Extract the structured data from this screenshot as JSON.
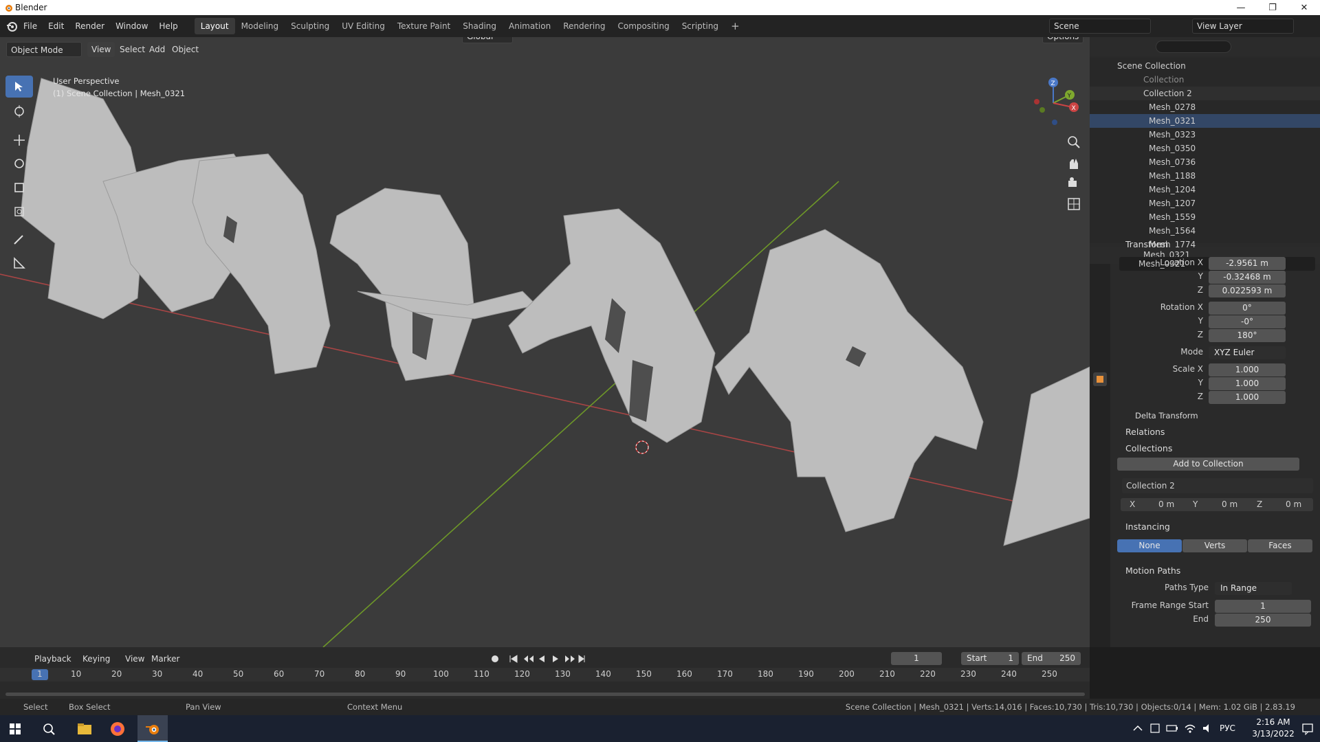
{
  "window": {
    "title": "Blender",
    "minimize": "—",
    "restore": "❐",
    "close": "✕"
  },
  "menu": [
    "File",
    "Edit",
    "Render",
    "Window",
    "Help"
  ],
  "workspaces": [
    "Layout",
    "Modeling",
    "Sculpting",
    "UV Editing",
    "Texture Paint",
    "Shading",
    "Animation",
    "Rendering",
    "Compositing",
    "Scripting"
  ],
  "active_workspace": "Layout",
  "scene": {
    "name": "Scene",
    "view_layer": "View Layer"
  },
  "viewport": {
    "mode": "Object Mode",
    "header_menus": [
      "View",
      "Select",
      "Add",
      "Object"
    ],
    "orientation": "Global",
    "options": "Options",
    "overlay_text_1": "User Perspective",
    "overlay_text_2": "(1) Scene Collection | Mesh_0321",
    "gizmo": {
      "x": "X",
      "y": "Y",
      "z": "Z"
    }
  },
  "outliner": {
    "root": "Scene Collection",
    "items": [
      {
        "name": "Collection",
        "level": 1
      },
      {
        "name": "Collection 2",
        "level": 1
      },
      {
        "name": "Mesh_0278",
        "level": 2
      },
      {
        "name": "Mesh_0321",
        "level": 2
      },
      {
        "name": "Mesh_0323",
        "level": 2
      },
      {
        "name": "Mesh_0350",
        "level": 2
      },
      {
        "name": "Mesh_0736",
        "level": 2
      },
      {
        "name": "Mesh_1188",
        "level": 2
      },
      {
        "name": "Mesh_1204",
        "level": 2
      },
      {
        "name": "Mesh_1207",
        "level": 2
      },
      {
        "name": "Mesh_1559",
        "level": 2
      },
      {
        "name": "Mesh_1564",
        "level": 2
      },
      {
        "name": "Mesh_1774",
        "level": 2
      }
    ]
  },
  "properties": {
    "object_name": "Mesh_0321",
    "data_name": "Mesh_0321",
    "transform_title": "Transform",
    "location_label": "Location X",
    "location": [
      "-2.9561 m",
      "-0.32468 m",
      "0.022593 m"
    ],
    "rotation_label": "Rotation X",
    "rotation": [
      "0°",
      "-0°",
      "180°"
    ],
    "mode_label": "Mode",
    "mode_value": "XYZ Euler",
    "scale_label": "Scale X",
    "scale": [
      "1.000",
      "1.000",
      "1.000"
    ],
    "axis_y": "Y",
    "axis_z": "Z",
    "delta_transform": "Delta Transform",
    "relations": "Relations",
    "collections": "Collections",
    "add_to_collection": "Add to Collection",
    "collection_name": "Collection 2",
    "offset": {
      "x_label": "X",
      "x": "0 m",
      "y_label": "Y",
      "y": "0 m",
      "z_label": "Z",
      "z": "0 m"
    },
    "instancing": "Instancing",
    "instancing_options": [
      "None",
      "Verts",
      "Faces"
    ],
    "motion_paths": "Motion Paths",
    "paths_type_label": "Paths Type",
    "paths_type": "In Range",
    "frame_range_start_label": "Frame Range Start",
    "frame_range_start": "1",
    "end_label": "End",
    "end": "250"
  },
  "timeline": {
    "menus": [
      "Playback",
      "Keying",
      "View",
      "Marker"
    ],
    "current_frame": "1",
    "start_label": "Start",
    "start": "1",
    "end_label": "End",
    "end": "250",
    "ticks": [
      "1",
      "10",
      "20",
      "30",
      "40",
      "50",
      "60",
      "70",
      "80",
      "90",
      "100",
      "110",
      "120",
      "130",
      "140",
      "150",
      "160",
      "170",
      "180",
      "190",
      "200",
      "210",
      "220",
      "230",
      "240",
      "250"
    ]
  },
  "statusbar": {
    "select": "Select",
    "box_select": "Box Select",
    "pan_view": "Pan View",
    "context_menu": "Context Menu",
    "stats": "Scene Collection | Mesh_0321 | Verts:14,016 | Faces:10,730 | Tris:10,730 | Objects:0/14 | Mem: 1.02 GiB | 2.83.19"
  },
  "taskbar": {
    "lang": "РУС",
    "time": "2:16 AM",
    "date": "3/13/2022"
  },
  "colors": {
    "accent": "#4772b3",
    "x_axis": "#b94848",
    "y_axis": "#7ea82e",
    "mesh": "#bcbcbc",
    "orange": "#e8913a"
  }
}
